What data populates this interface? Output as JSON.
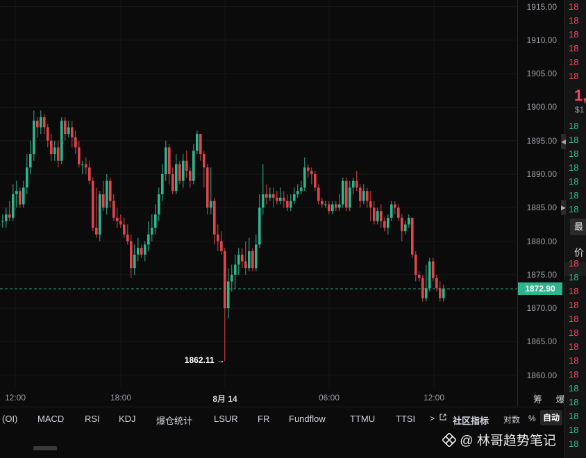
{
  "chart_data": {
    "type": "candlestick",
    "x_labels": [
      "12:00",
      "18:00",
      "8月 14",
      "06:00",
      "12:00"
    ],
    "y_ticks": [
      "1915.00",
      "1910.00",
      "1905.00",
      "1900.00",
      "1895.00",
      "1890.00",
      "1885.00",
      "1880.00",
      "1875.00",
      "1870.00",
      "1865.00",
      "1860.00"
    ],
    "ylim": [
      1858,
      1916
    ],
    "current_price": "1872.90",
    "low_marker": "1862.11",
    "up_color": "#2fb58e",
    "down_color": "#e0454d",
    "candles": [
      [
        1883.0,
        1883.0,
        1882.0,
        1884.0
      ],
      [
        1883.0,
        1884.0,
        1882.0,
        1885.0
      ],
      [
        1884.0,
        1883.5,
        1883.0,
        1886.0
      ],
      [
        1883.5,
        1887.0,
        1883.0,
        1888.5
      ],
      [
        1887.0,
        1887.5,
        1885.0,
        1889.0
      ],
      [
        1887.5,
        1885.5,
        1885.0,
        1888.0
      ],
      [
        1885.5,
        1888.0,
        1885.0,
        1889.0
      ],
      [
        1888.0,
        1891.0,
        1887.0,
        1893.0
      ],
      [
        1891.0,
        1893.0,
        1890.0,
        1895.0
      ],
      [
        1893.0,
        1898.0,
        1892.0,
        1899.5
      ],
      [
        1898.0,
        1897.0,
        1895.5,
        1898.5
      ],
      [
        1897.0,
        1898.5,
        1896.0,
        1899.5
      ],
      [
        1898.5,
        1897.0,
        1896.0,
        1899.0
      ],
      [
        1897.0,
        1895.0,
        1894.0,
        1897.5
      ],
      [
        1895.0,
        1893.0,
        1892.0,
        1896.0
      ],
      [
        1893.0,
        1894.0,
        1892.0,
        1895.0
      ],
      [
        1894.0,
        1892.0,
        1891.0,
        1895.0
      ],
      [
        1892.0,
        1898.0,
        1891.5,
        1898.5
      ],
      [
        1898.0,
        1896.0,
        1895.0,
        1898.5
      ],
      [
        1896.0,
        1897.0,
        1895.5,
        1898.0
      ],
      [
        1897.0,
        1895.5,
        1894.0,
        1898.0
      ],
      [
        1895.5,
        1894.0,
        1893.0,
        1896.5
      ],
      [
        1894.0,
        1891.5,
        1891.0,
        1895.0
      ],
      [
        1891.5,
        1891.5,
        1890.0,
        1892.0
      ],
      [
        1891.5,
        1891.0,
        1890.0,
        1892.5
      ],
      [
        1891.0,
        1889.0,
        1888.5,
        1892.0
      ],
      [
        1889.0,
        1882.0,
        1881.5,
        1889.5
      ],
      [
        1882.0,
        1881.0,
        1880.5,
        1888.0
      ],
      [
        1881.0,
        1887.0,
        1880.0,
        1887.5
      ],
      [
        1887.0,
        1885.0,
        1884.5,
        1889.0
      ],
      [
        1885.0,
        1889.0,
        1884.0,
        1890.0
      ],
      [
        1889.0,
        1886.0,
        1885.0,
        1889.5
      ],
      [
        1886.0,
        1883.5,
        1883.0,
        1887.0
      ],
      [
        1883.5,
        1883.0,
        1882.0,
        1885.0
      ],
      [
        1883.0,
        1882.5,
        1882.0,
        1884.0
      ],
      [
        1882.5,
        1881.0,
        1880.5,
        1883.5
      ],
      [
        1881.0,
        1880.0,
        1879.5,
        1882.5
      ],
      [
        1880.0,
        1876.0,
        1874.5,
        1881.0
      ],
      [
        1876.0,
        1878.0,
        1875.0,
        1879.5
      ],
      [
        1878.0,
        1879.0,
        1877.0,
        1880.5
      ],
      [
        1879.0,
        1878.0,
        1877.5,
        1879.5
      ],
      [
        1878.0,
        1879.5,
        1877.0,
        1880.0
      ],
      [
        1879.5,
        1881.0,
        1878.5,
        1883.0
      ],
      [
        1881.0,
        1882.0,
        1880.0,
        1884.0
      ],
      [
        1882.0,
        1884.0,
        1881.0,
        1885.5
      ],
      [
        1884.0,
        1887.0,
        1883.0,
        1888.0
      ],
      [
        1887.0,
        1890.0,
        1886.0,
        1891.5
      ],
      [
        1890.0,
        1894.0,
        1889.0,
        1895.0
      ],
      [
        1894.0,
        1890.0,
        1888.5,
        1894.5
      ],
      [
        1890.0,
        1887.5,
        1887.0,
        1891.0
      ],
      [
        1887.5,
        1891.5,
        1887.0,
        1893.0
      ],
      [
        1891.5,
        1889.0,
        1888.5,
        1892.0
      ],
      [
        1889.0,
        1892.0,
        1888.0,
        1893.0
      ],
      [
        1892.0,
        1890.5,
        1889.5,
        1893.5
      ],
      [
        1890.5,
        1889.0,
        1888.0,
        1891.0
      ],
      [
        1889.0,
        1893.5,
        1888.5,
        1894.5
      ],
      [
        1893.5,
        1896.0,
        1893.0,
        1896.5
      ],
      [
        1896.0,
        1893.0,
        1892.0,
        1896.0
      ],
      [
        1893.0,
        1891.0,
        1888.0,
        1893.5
      ],
      [
        1891.0,
        1885.0,
        1884.0,
        1891.5
      ],
      [
        1885.0,
        1886.0,
        1884.0,
        1891.0
      ],
      [
        1886.0,
        1881.0,
        1879.5,
        1886.5
      ],
      [
        1881.0,
        1880.0,
        1878.5,
        1882.5
      ],
      [
        1880.0,
        1878.5,
        1878.0,
        1881.5
      ],
      [
        1878.5,
        1870.0,
        1862.1,
        1879.0
      ],
      [
        1870.0,
        1874.0,
        1868.5,
        1876.0
      ],
      [
        1874.0,
        1875.0,
        1872.5,
        1876.5
      ],
      [
        1875.0,
        1876.5,
        1873.0,
        1878.0
      ],
      [
        1876.5,
        1878.0,
        1875.0,
        1879.0
      ],
      [
        1878.0,
        1877.0,
        1876.0,
        1879.0
      ],
      [
        1877.0,
        1876.0,
        1875.0,
        1880.0
      ],
      [
        1876.0,
        1878.5,
        1875.5,
        1880.5
      ],
      [
        1878.5,
        1876.0,
        1875.5,
        1879.0
      ],
      [
        1876.0,
        1879.5,
        1875.5,
        1881.0
      ],
      [
        1879.5,
        1885.0,
        1879.0,
        1887.0
      ],
      [
        1885.0,
        1887.0,
        1884.0,
        1891.5
      ],
      [
        1887.0,
        1886.5,
        1885.5,
        1888.5
      ],
      [
        1886.5,
        1887.0,
        1886.0,
        1888.0
      ],
      [
        1887.0,
        1886.5,
        1885.0,
        1888.0
      ],
      [
        1886.5,
        1886.0,
        1885.5,
        1887.5
      ],
      [
        1886.0,
        1886.5,
        1885.5,
        1888.0
      ],
      [
        1886.5,
        1886.0,
        1885.0,
        1887.5
      ],
      [
        1886.0,
        1885.0,
        1884.5,
        1887.0
      ],
      [
        1885.0,
        1886.0,
        1884.5,
        1887.0
      ],
      [
        1886.0,
        1887.0,
        1885.5,
        1888.0
      ],
      [
        1887.0,
        1887.5,
        1886.5,
        1888.5
      ],
      [
        1887.5,
        1888.0,
        1887.0,
        1889.0
      ],
      [
        1888.0,
        1891.0,
        1887.5,
        1892.5
      ],
      [
        1891.0,
        1890.5,
        1889.5,
        1891.5
      ],
      [
        1890.5,
        1890.0,
        1888.5,
        1891.0
      ],
      [
        1890.0,
        1888.0,
        1887.5,
        1890.5
      ],
      [
        1888.0,
        1886.0,
        1885.5,
        1888.5
      ],
      [
        1886.0,
        1885.5,
        1885.0,
        1886.5
      ],
      [
        1885.5,
        1885.5,
        1885.0,
        1886.0
      ],
      [
        1885.5,
        1884.5,
        1884.0,
        1886.0
      ],
      [
        1884.5,
        1885.5,
        1884.0,
        1886.0
      ],
      [
        1885.5,
        1885.0,
        1884.5,
        1886.0
      ],
      [
        1885.0,
        1885.5,
        1884.5,
        1887.0
      ],
      [
        1885.5,
        1889.0,
        1885.0,
        1889.5
      ],
      [
        1889.0,
        1885.0,
        1884.5,
        1889.5
      ],
      [
        1885.0,
        1888.0,
        1884.5,
        1889.0
      ],
      [
        1888.0,
        1889.0,
        1887.0,
        1889.5
      ],
      [
        1889.0,
        1888.0,
        1887.5,
        1890.5
      ],
      [
        1888.0,
        1886.0,
        1885.0,
        1888.5
      ],
      [
        1886.0,
        1887.5,
        1885.5,
        1888.5
      ],
      [
        1887.5,
        1886.0,
        1885.0,
        1888.0
      ],
      [
        1886.0,
        1885.0,
        1883.0,
        1887.5
      ],
      [
        1885.0,
        1883.0,
        1882.5,
        1886.0
      ],
      [
        1883.0,
        1884.5,
        1882.5,
        1885.0
      ],
      [
        1884.5,
        1883.0,
        1882.0,
        1885.5
      ],
      [
        1883.0,
        1882.0,
        1881.5,
        1883.5
      ],
      [
        1882.0,
        1883.5,
        1881.0,
        1884.0
      ],
      [
        1883.5,
        1885.5,
        1883.0,
        1886.0
      ],
      [
        1885.5,
        1885.0,
        1884.0,
        1886.0
      ],
      [
        1885.0,
        1883.5,
        1883.0,
        1885.5
      ],
      [
        1883.5,
        1881.5,
        1880.0,
        1884.0
      ],
      [
        1881.5,
        1882.5,
        1881.0,
        1883.0
      ],
      [
        1882.5,
        1883.5,
        1882.0,
        1884.0
      ],
      [
        1883.5,
        1878.0,
        1877.5,
        1883.5
      ],
      [
        1878.0,
        1875.0,
        1874.0,
        1878.5
      ],
      [
        1875.0,
        1874.5,
        1874.0,
        1875.5
      ],
      [
        1874.5,
        1871.5,
        1871.0,
        1875.0
      ],
      [
        1871.5,
        1873.0,
        1871.0,
        1876.5
      ],
      [
        1873.0,
        1877.0,
        1872.5,
        1877.5
      ],
      [
        1877.0,
        1874.5,
        1874.0,
        1877.5
      ],
      [
        1874.5,
        1873.0,
        1872.5,
        1875.0
      ],
      [
        1873.0,
        1871.5,
        1871.0,
        1874.0
      ],
      [
        1871.5,
        1872.9,
        1871.0,
        1873.5
      ]
    ]
  },
  "toolbar": {
    "items": [
      "(OI)",
      "MACD",
      "RSI",
      "KDJ",
      "爆仓统计",
      "LSUR",
      "FR",
      "Fundflow",
      "TTMU",
      "TTSI"
    ],
    "more_icon": "chevron-right-icon",
    "community_icon": "external-link-icon",
    "community_label": "社区指标",
    "log_label": "对数",
    "percent_label": "%",
    "auto_label": "自动",
    "axis_corner_label": "筹 爆"
  },
  "watermark": {
    "icon": "binance-square-icon",
    "text": "@ 林哥趋势笔记"
  },
  "orderbook": {
    "prefix": "18",
    "last_price_fragment": "1,",
    "usd_fragment": "$1",
    "button_label": "最",
    "column_label": "价",
    "ask_color": "#f6465d",
    "bid_color": "#2ebd85"
  }
}
